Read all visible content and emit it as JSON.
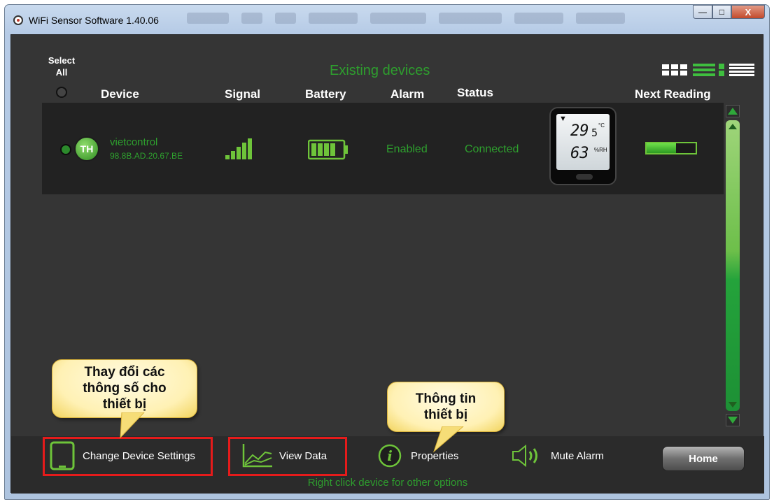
{
  "window": {
    "title": "WiFi Sensor Software 1.40.06"
  },
  "header": {
    "select_all": "Select All",
    "existing_devices": "Existing devices",
    "columns": {
      "device": "Device",
      "signal": "Signal",
      "battery": "Battery",
      "alarm": "Alarm",
      "status": "Status",
      "next_reading": "Next Reading"
    }
  },
  "device": {
    "badge": "TH",
    "name": "vietcontrol",
    "mac": "98.8B.AD.20.67.BE",
    "alarm": "Enabled",
    "status": "Connected",
    "temperature": "29",
    "temperature_decimal": "5",
    "temperature_unit": "°C",
    "humidity": "63",
    "humidity_unit": "%RH",
    "next_reading_progress": 0.6
  },
  "toolbar": {
    "change_settings": "Change Device Settings",
    "view_data": "View Data",
    "properties": "Properties",
    "mute_alarm": "Mute Alarm",
    "home": "Home",
    "hint": "Right click device for other options"
  },
  "callouts": {
    "settings_line1": "Thay đổi các",
    "settings_line2": "thông số cho",
    "settings_line3": "thiết bị",
    "info_line1": "Thông tin",
    "info_line2": "thiết bị"
  },
  "colors": {
    "accent_green": "#2ea02e",
    "highlight_red": "#e51b1b"
  }
}
